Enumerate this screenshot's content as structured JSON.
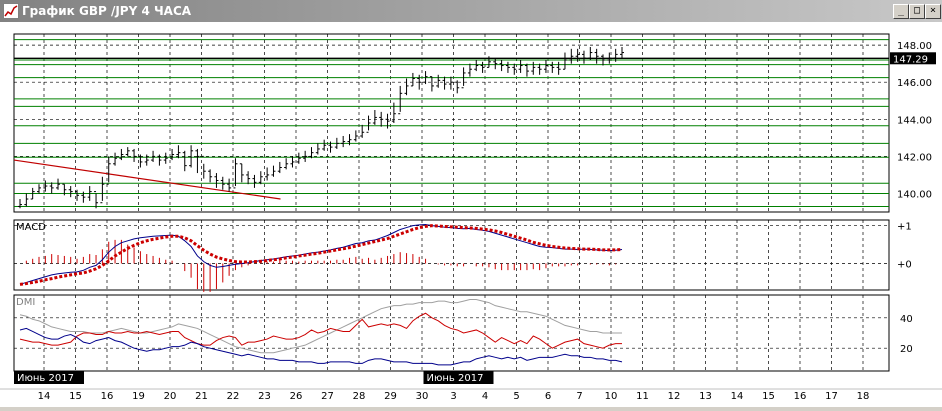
{
  "window": {
    "title": "График GBP /JPY  4 ЧАСА",
    "btn_min": "_",
    "btn_max": "□",
    "btn_close": "×"
  },
  "colors": {
    "price": "#000000",
    "green_levels": "#008000",
    "trendline": "#c00000",
    "macd_line": "#00008b",
    "macd_signal": "#cc0000",
    "dmi_adx": "#a0a0a0",
    "dmi_plus": "#cc0000",
    "dmi_minus": "#00008b",
    "current_price_bg": "#000000"
  },
  "chart_data": {
    "type": "candlestick",
    "x_axis": {
      "tick_labels": [
        "14",
        "15",
        "16",
        "19",
        "20",
        "21",
        "22",
        "23",
        "26",
        "27",
        "28",
        "29",
        "30",
        "3",
        "4",
        "5",
        "6",
        "7",
        "10",
        "11",
        "12",
        "13",
        "14",
        "15",
        "16",
        "17",
        "18"
      ],
      "month_markers": [
        {
          "label": "Июнь 2017",
          "at": "14"
        },
        {
          "label": "Июнь 2017",
          "at": "3"
        }
      ]
    },
    "price_panel": {
      "y_ticks": [
        {
          "value": 140,
          "label": "140.00"
        },
        {
          "value": 142,
          "label": "142.00"
        },
        {
          "value": 144,
          "label": "144.00"
        },
        {
          "value": 146,
          "label": "146.00"
        },
        {
          "value": 148,
          "label": "148.00"
        }
      ],
      "ylim": [
        139.0,
        148.6
      ],
      "current_price": {
        "value": 147.29,
        "label": "147.29"
      },
      "horizontal_levels": [
        148.3,
        147.2,
        146.95,
        146.25,
        145.1,
        144.7,
        143.65,
        142.7,
        141.95,
        140.55,
        140.0,
        139.3
      ],
      "trendline": {
        "from": {
          "day": "14",
          "value": 141.8
        },
        "to": {
          "day": "23",
          "value": 139.7
        }
      },
      "close": [
        139.4,
        139.7,
        140.1,
        140.3,
        140.4,
        140.3,
        140.5,
        140.2,
        140.1,
        139.9,
        139.8,
        140.1,
        139.5,
        140.5,
        141.6,
        141.9,
        142.1,
        142.3,
        142.0,
        141.7,
        141.8,
        142.0,
        141.8,
        141.9,
        142.1,
        142.2,
        141.5,
        142.3,
        142.0,
        141.2,
        140.9,
        140.7,
        140.5,
        140.3,
        141.6,
        141.0,
        140.8,
        140.6,
        140.9,
        141.0,
        141.2,
        141.4,
        141.6,
        141.7,
        141.9,
        142.0,
        142.2,
        142.4,
        142.6,
        142.5,
        142.7,
        142.8,
        142.9,
        143.1,
        143.3,
        143.8,
        144.1,
        144.0,
        143.9,
        144.3,
        145.4,
        145.8,
        146.2,
        146.0,
        146.3,
        145.8,
        146.1,
        145.9,
        146.0,
        145.7,
        146.5,
        146.7,
        146.9,
        146.8,
        147.1,
        147.0,
        146.9,
        146.8,
        146.7,
        146.9,
        146.6,
        146.8,
        146.7,
        146.9,
        146.8,
        146.7,
        147.2,
        147.4,
        147.5,
        147.3,
        147.6,
        147.4,
        147.2,
        147.3,
        147.5,
        147.6
      ],
      "high": [
        139.7,
        140.0,
        140.3,
        140.5,
        140.7,
        140.6,
        140.8,
        140.5,
        140.4,
        140.2,
        140.1,
        140.4,
        140.0,
        140.9,
        142.0,
        142.2,
        142.4,
        142.5,
        142.4,
        142.1,
        142.1,
        142.3,
        142.1,
        142.2,
        142.4,
        142.6,
        142.3,
        142.6,
        142.4,
        141.6,
        141.3,
        141.1,
        140.9,
        140.8,
        141.9,
        141.6,
        141.2,
        141.0,
        141.2,
        141.4,
        141.5,
        141.7,
        141.9,
        142.0,
        142.2,
        142.3,
        142.5,
        142.7,
        142.9,
        142.8,
        143.0,
        143.1,
        143.2,
        143.4,
        143.7,
        144.2,
        144.5,
        144.4,
        144.3,
        144.9,
        145.8,
        146.2,
        146.5,
        146.4,
        146.6,
        146.3,
        146.4,
        146.3,
        146.3,
        146.1,
        146.8,
        147.0,
        147.2,
        147.1,
        147.4,
        147.3,
        147.2,
        147.1,
        147.0,
        147.2,
        147.0,
        147.1,
        147.0,
        147.2,
        147.1,
        147.1,
        147.6,
        147.8,
        147.8,
        147.7,
        147.9,
        147.8,
        147.5,
        147.6,
        147.8,
        147.9
      ],
      "low": [
        139.2,
        139.3,
        139.7,
        140.0,
        140.1,
        140.0,
        140.2,
        139.9,
        139.8,
        139.6,
        139.5,
        139.6,
        139.2,
        139.6,
        140.6,
        141.5,
        141.8,
        142.0,
        141.7,
        141.4,
        141.5,
        141.7,
        141.5,
        141.6,
        141.8,
        141.9,
        141.2,
        141.4,
        141.1,
        140.8,
        140.6,
        140.3,
        140.2,
        140.1,
        140.4,
        140.6,
        140.5,
        140.3,
        140.5,
        140.7,
        140.9,
        141.1,
        141.3,
        141.4,
        141.6,
        141.7,
        141.9,
        142.1,
        142.3,
        142.2,
        142.4,
        142.5,
        142.6,
        142.8,
        143.0,
        143.4,
        143.7,
        143.6,
        143.5,
        143.8,
        144.4,
        145.3,
        145.8,
        145.6,
        145.9,
        145.5,
        145.7,
        145.6,
        145.6,
        145.4,
        145.8,
        146.3,
        146.6,
        146.5,
        146.8,
        146.7,
        146.6,
        146.5,
        146.4,
        146.5,
        146.3,
        146.4,
        146.4,
        146.5,
        146.5,
        146.4,
        146.7,
        147.0,
        147.1,
        147.0,
        147.2,
        147.0,
        146.9,
        147.0,
        147.1,
        147.3
      ]
    },
    "macd_panel": {
      "label": "MACD",
      "y_ticks": [
        {
          "value": 1,
          "label": "+1"
        },
        {
          "value": 0,
          "label": "+0"
        }
      ],
      "ylim": [
        -0.7,
        1.15
      ],
      "macd": [
        -0.55,
        -0.5,
        -0.45,
        -0.4,
        -0.35,
        -0.3,
        -0.27,
        -0.25,
        -0.23,
        -0.22,
        -0.18,
        -0.1,
        -0.05,
        0.1,
        0.3,
        0.45,
        0.55,
        0.6,
        0.65,
        0.68,
        0.7,
        0.72,
        0.73,
        0.74,
        0.75,
        0.72,
        0.6,
        0.45,
        0.2,
        0.05,
        -0.05,
        -0.1,
        -0.08,
        -0.05,
        -0.02,
        0.0,
        0.02,
        0.05,
        0.08,
        0.1,
        0.12,
        0.15,
        0.18,
        0.2,
        0.22,
        0.25,
        0.28,
        0.3,
        0.33,
        0.36,
        0.4,
        0.43,
        0.48,
        0.53,
        0.55,
        0.6,
        0.62,
        0.68,
        0.74,
        0.82,
        0.9,
        0.95,
        1.0,
        1.02,
        1.03,
        1.0,
        0.98,
        0.96,
        0.95,
        0.93,
        0.92,
        0.93,
        0.9,
        0.88,
        0.85,
        0.8,
        0.75,
        0.7,
        0.65,
        0.6,
        0.55,
        0.5,
        0.45,
        0.43,
        0.42,
        0.4,
        0.38,
        0.38,
        0.37,
        0.38,
        0.37,
        0.36,
        0.35,
        0.34,
        0.35,
        0.37
      ],
      "signal": [
        -0.55,
        -0.53,
        -0.5,
        -0.47,
        -0.43,
        -0.4,
        -0.36,
        -0.33,
        -0.3,
        -0.27,
        -0.25,
        -0.2,
        -0.14,
        -0.05,
        0.07,
        0.2,
        0.3,
        0.4,
        0.48,
        0.55,
        0.6,
        0.64,
        0.67,
        0.7,
        0.72,
        0.72,
        0.68,
        0.6,
        0.47,
        0.35,
        0.25,
        0.17,
        0.12,
        0.08,
        0.05,
        0.04,
        0.04,
        0.05,
        0.06,
        0.08,
        0.1,
        0.12,
        0.15,
        0.17,
        0.2,
        0.22,
        0.25,
        0.27,
        0.3,
        0.33,
        0.36,
        0.39,
        0.42,
        0.46,
        0.5,
        0.54,
        0.58,
        0.62,
        0.66,
        0.72,
        0.78,
        0.84,
        0.9,
        0.95,
        0.98,
        1.0,
        0.99,
        0.98,
        0.97,
        0.96,
        0.95,
        0.94,
        0.93,
        0.91,
        0.89,
        0.86,
        0.82,
        0.77,
        0.72,
        0.67,
        0.62,
        0.56,
        0.52,
        0.48,
        0.45,
        0.43,
        0.41,
        0.4,
        0.39,
        0.38,
        0.38,
        0.37,
        0.36,
        0.36,
        0.36,
        0.37
      ]
    },
    "dmi_panel": {
      "label": "DMI",
      "y_ticks": [
        {
          "value": 40,
          "label": "40"
        },
        {
          "value": 20,
          "label": "20"
        }
      ],
      "ylim": [
        5,
        55
      ],
      "adx": [
        42,
        41,
        39,
        38,
        36,
        34,
        33,
        32,
        31,
        31,
        31,
        30,
        30,
        30,
        31,
        32,
        33,
        32,
        31,
        30,
        30,
        31,
        32,
        33,
        34,
        36,
        35,
        34,
        33,
        31,
        29,
        27,
        25,
        23,
        21,
        20,
        19,
        18,
        17,
        17,
        17,
        18,
        19,
        20,
        21,
        22,
        24,
        26,
        28,
        30,
        32,
        34,
        36,
        38,
        40,
        42,
        44,
        46,
        47,
        48,
        48,
        49,
        49,
        50,
        50,
        50,
        51,
        51,
        50,
        50,
        51,
        52,
        52,
        51,
        50,
        48,
        47,
        46,
        45,
        44,
        44,
        43,
        42,
        41,
        39,
        37,
        35,
        34,
        33,
        32,
        31,
        31,
        30,
        30,
        30,
        30
      ],
      "di_plus": [
        26,
        25,
        24,
        24,
        23,
        22,
        22,
        23,
        24,
        28,
        30,
        30,
        29,
        29,
        31,
        30,
        30,
        31,
        30,
        30,
        31,
        30,
        29,
        30,
        31,
        31,
        27,
        25,
        23,
        22,
        22,
        25,
        27,
        28,
        27,
        22,
        24,
        24,
        25,
        26,
        28,
        27,
        26,
        26,
        27,
        29,
        32,
        30,
        31,
        33,
        32,
        31,
        31,
        35,
        39,
        34,
        35,
        36,
        35,
        36,
        35,
        33,
        38,
        41,
        43,
        40,
        38,
        35,
        33,
        32,
        30,
        31,
        32,
        30,
        27,
        24,
        27,
        25,
        23,
        25,
        23,
        28,
        26,
        23,
        20,
        22,
        24,
        25,
        26,
        23,
        22,
        21,
        20,
        22,
        23,
        23
      ],
      "di_minus": [
        32,
        33,
        31,
        29,
        27,
        26,
        26,
        28,
        29,
        27,
        24,
        23,
        25,
        26,
        27,
        25,
        24,
        22,
        20,
        19,
        18,
        19,
        19,
        20,
        21,
        21,
        22,
        24,
        23,
        21,
        20,
        19,
        18,
        17,
        16,
        15,
        16,
        15,
        14,
        13,
        13,
        12,
        12,
        12,
        11,
        11,
        11,
        10,
        10,
        11,
        11,
        11,
        11,
        10,
        10,
        12,
        13,
        13,
        12,
        11,
        11,
        11,
        10,
        10,
        10,
        10,
        9,
        9,
        9,
        10,
        11,
        11,
        13,
        14,
        15,
        14,
        13,
        14,
        13,
        14,
        12,
        13,
        14,
        14,
        14,
        15,
        16,
        15,
        15,
        14,
        14,
        13,
        13,
        12,
        12,
        11
      ]
    }
  }
}
